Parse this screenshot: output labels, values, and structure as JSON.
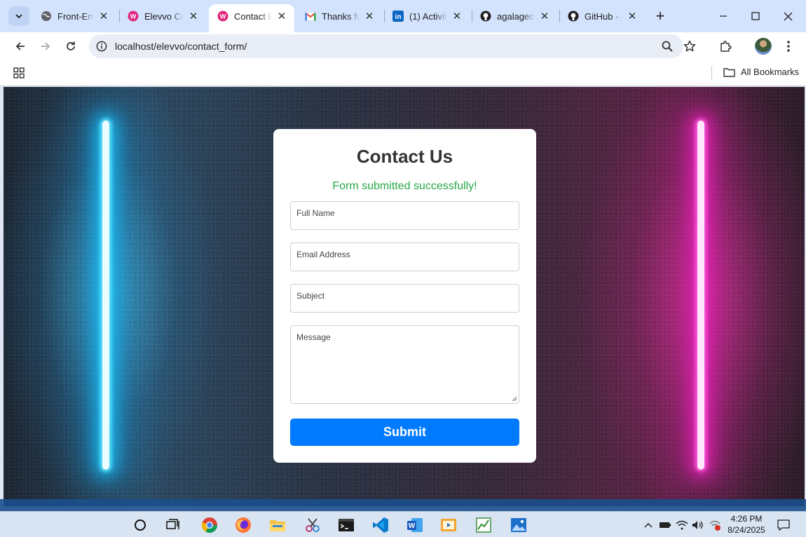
{
  "browser": {
    "tabs": [
      {
        "title": "Front-End",
        "icon": "globe-icon",
        "active": false
      },
      {
        "title": "Elevvo Co",
        "icon": "wamp-icon",
        "active": false
      },
      {
        "title": "Contact Fo",
        "icon": "wamp-icon",
        "active": true
      },
      {
        "title": "Thanks for",
        "icon": "gmail-icon",
        "active": false
      },
      {
        "title": "(1) Activity",
        "icon": "linkedin-icon",
        "active": false
      },
      {
        "title": "agalageor",
        "icon": "github-icon",
        "active": false
      },
      {
        "title": "GitHub - N",
        "icon": "github-icon",
        "active": false
      }
    ],
    "url": "localhost/elevvo/contact_form/",
    "bookmarks_label": "All Bookmarks"
  },
  "form": {
    "heading": "Contact Us",
    "success_message": "Form submitted successfully!",
    "full_name_placeholder": "Full Name",
    "email_placeholder": "Email Address",
    "subject_placeholder": "Subject",
    "message_placeholder": "Message",
    "submit_label": "Submit",
    "success_color": "#28a745",
    "button_color": "#007bff"
  },
  "taskbar": {
    "time": "4:26 PM",
    "date": "8/24/2025"
  }
}
